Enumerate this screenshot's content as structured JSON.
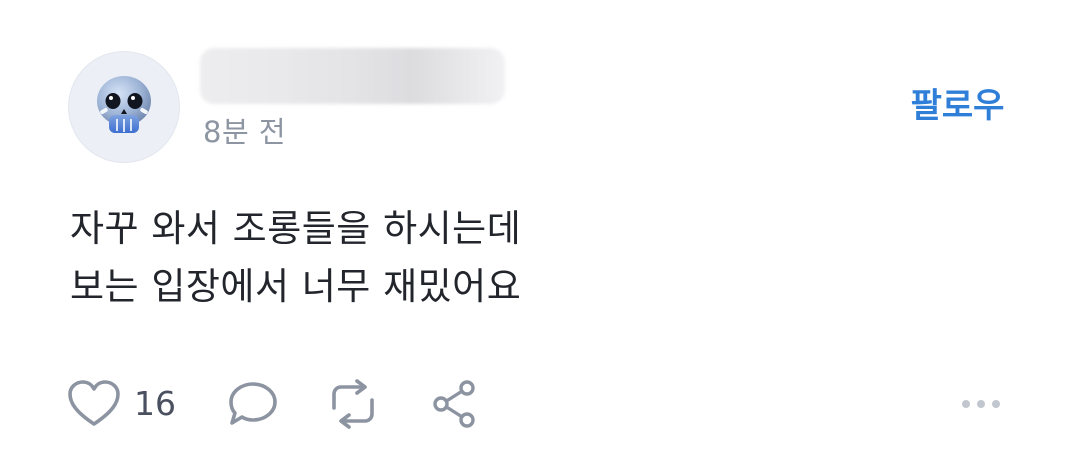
{
  "post": {
    "author": {
      "name": "",
      "avatar_icon": "skull-emoji-icon"
    },
    "timestamp": "8분 전",
    "follow_label": "팔로우",
    "content_lines": [
      "자꾸 와서 조롱들을 하시는데",
      "보는 입장에서 너무 재밌어요"
    ],
    "actions": {
      "like_count": "16",
      "like_icon": "heart-icon",
      "comment_icon": "comment-bubble-icon",
      "repost_icon": "repost-icon",
      "share_icon": "share-icon",
      "more_icon": "more-dots-icon"
    }
  },
  "colors": {
    "accent": "#2f7fd8",
    "text_primary": "#22252b",
    "text_secondary": "#8e95a2",
    "icon": "#8d94a1",
    "avatar_bg": "#eceff5"
  }
}
